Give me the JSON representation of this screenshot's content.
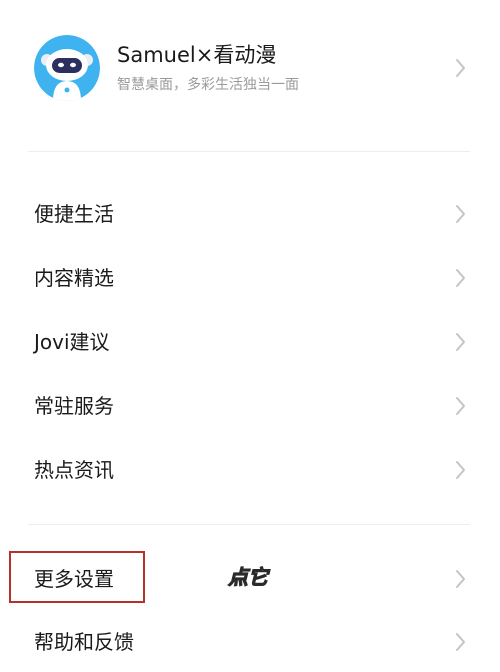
{
  "profile": {
    "name": "Samuel×看动漫",
    "subtitle": "智慧桌面，多彩生活独当一面"
  },
  "menu_group_1": [
    {
      "label": "便捷生活"
    },
    {
      "label": "内容精选"
    },
    {
      "label": "Jovi建议"
    },
    {
      "label": "常驻服务"
    },
    {
      "label": "热点资讯"
    }
  ],
  "menu_group_2": [
    {
      "label": "更多设置"
    },
    {
      "label": "帮助和反馈"
    }
  ],
  "annotation": {
    "text": "点它",
    "color": "#f5d23a",
    "highlight_color": "#b5322a"
  },
  "icons": {
    "avatar": "robot-avatar-icon",
    "chevron": "chevron-right-icon"
  }
}
